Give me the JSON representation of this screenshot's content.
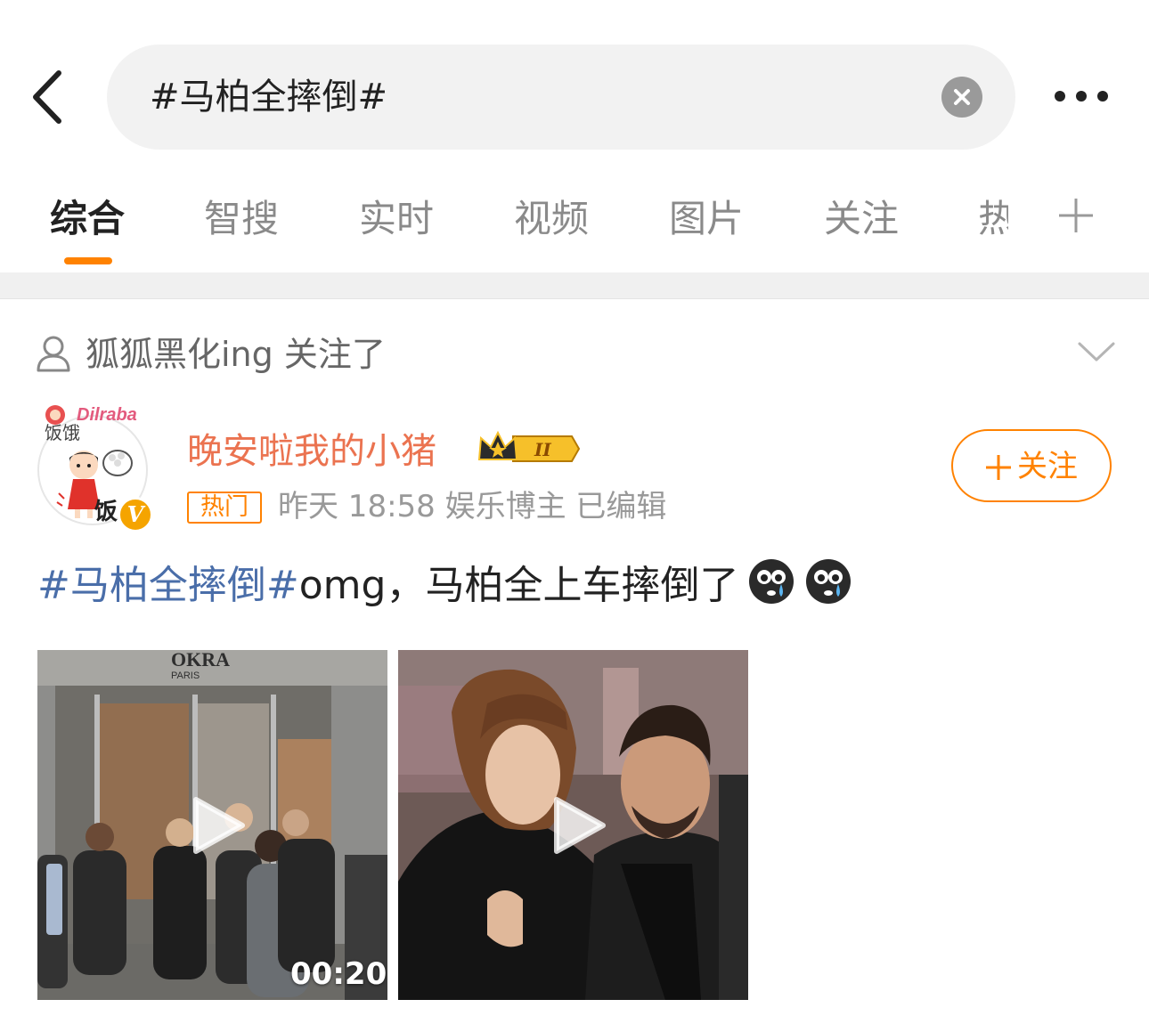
{
  "search": {
    "query": "#马柏全摔倒#"
  },
  "tabs": [
    {
      "label": "综合",
      "active": true
    },
    {
      "label": "智搜"
    },
    {
      "label": "实时"
    },
    {
      "label": "视频"
    },
    {
      "label": "图片"
    },
    {
      "label": "关注"
    },
    {
      "label": "热"
    }
  ],
  "notice": {
    "text": "狐狐黑化ing 关注了"
  },
  "author": {
    "name": "晚安啦我的小猪",
    "avatar_text": "Dilraba",
    "avatar_side_text": "饭饿",
    "avatar_corner_text": "饭",
    "verified_mark": "V",
    "vip_level": "II",
    "hot_tag": "热门",
    "meta": "昨天 18:58  娱乐博主  已编辑",
    "follow_label": "关注"
  },
  "post": {
    "hashtag": "#马柏全摔倒#",
    "text": "omg，马柏全上车摔倒了"
  },
  "videos": [
    {
      "duration": "00:20",
      "store_sign": "PARIS",
      "store_sign_top": "OKRA"
    },
    {
      "duration": ""
    }
  ],
  "colors": {
    "accent": "#ff8200",
    "username": "#eb7350",
    "hashtag": "#4a6ea9"
  },
  "icons": [
    "back-arrow-icon",
    "clear-icon",
    "more-icon",
    "plus-icon",
    "person-icon",
    "chevron-down-icon",
    "crown-icon",
    "verified-icon",
    "crying-emoji-icon",
    "play-icon"
  ]
}
